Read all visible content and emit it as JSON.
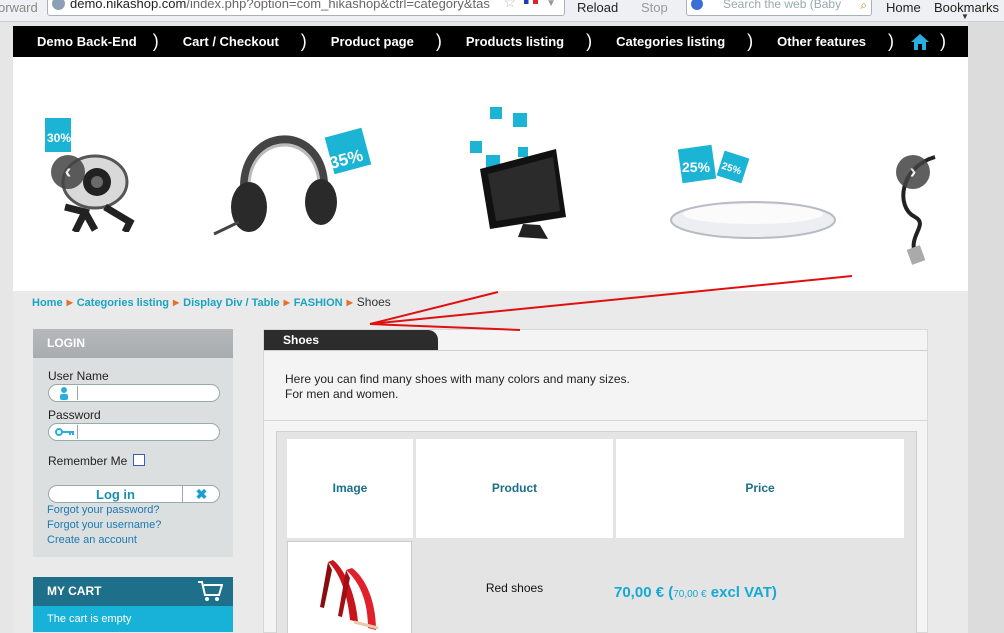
{
  "browser": {
    "back_fwd_label": "orward",
    "url_host": "demo.nikashop.com",
    "url_path": "/index.php?option=com_hikashop&ctrl=category&tas",
    "reload_label": "Reload",
    "stop_label": "Stop",
    "search_placeholder": "Search the web (Baby",
    "home_label": "Home",
    "bookmarks_label": "Bookmarks"
  },
  "topnav": {
    "items": [
      "Demo Back-End",
      "Cart / Checkout",
      "Product page",
      "Products listing",
      "Categories listing",
      "Other features"
    ],
    "home_icon": "home-icon"
  },
  "slider": {
    "prev_label": "‹",
    "next_label": "›",
    "badges": [
      "30%",
      "35%",
      "25%",
      "25%"
    ]
  },
  "breadcrumb": {
    "items": [
      "Home",
      "Categories listing",
      "Display Div / Table",
      "FASHION"
    ],
    "current": "Shoes"
  },
  "login": {
    "title": "LOGIN",
    "username_label": "User Name",
    "password_label": "Password",
    "remember_label": "Remember Me",
    "submit_label": "Log in",
    "forgot_password": "Forgot your password?",
    "forgot_username": "Forgot your username?",
    "create_account": "Create an account"
  },
  "cart": {
    "title": "MY CART",
    "status": "The cart is empty"
  },
  "category": {
    "title": "Shoes",
    "desc_line1": "Here you can find many shoes with many colors and many sizes.",
    "desc_line2": "For men and women."
  },
  "table": {
    "headers": [
      "Image",
      "Product",
      "Price"
    ],
    "rows": [
      {
        "product": "Red shoes",
        "price_main": "70,00 €",
        "price_open": "(",
        "price_excl": "70,00 €",
        "price_vat": "excl VAT)"
      }
    ]
  },
  "colors": {
    "accent": "#1aa3c2",
    "nav_bg": "#000000",
    "annotation": "#e01010"
  }
}
